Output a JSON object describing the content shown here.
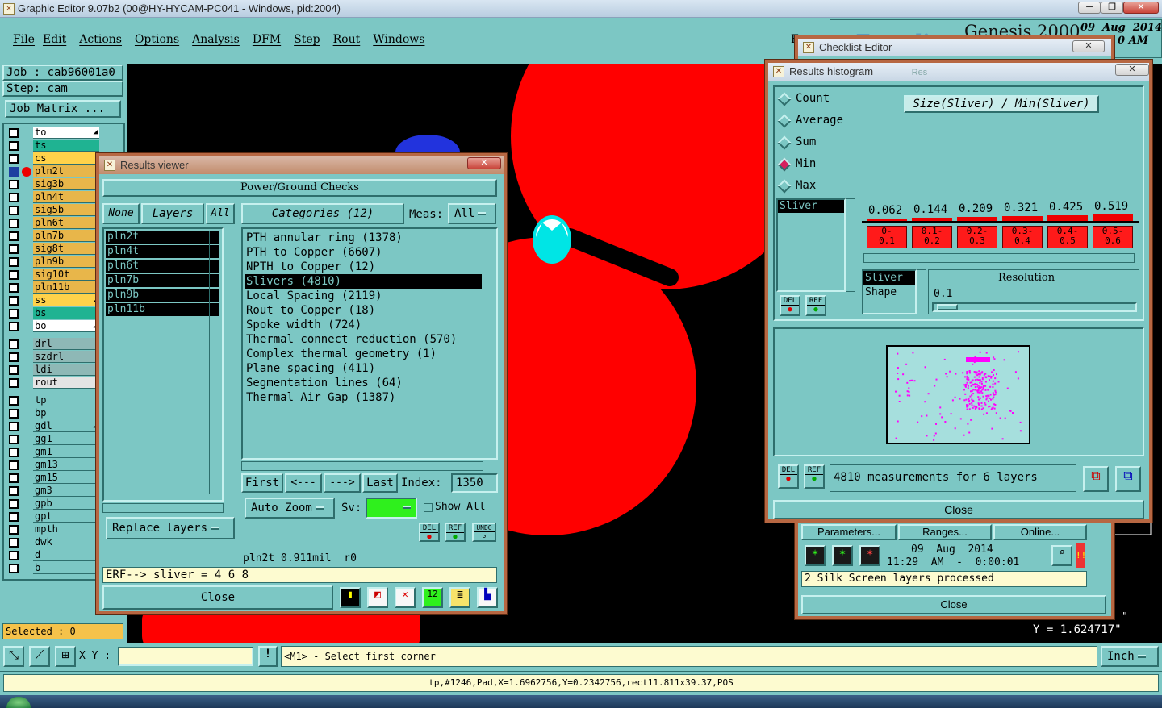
{
  "app": {
    "title": "Graphic Editor 9.07b2 (00@HY-HYCAM-PC041 - Windows, pid:2004)",
    "menu": [
      "File",
      "Edit",
      "Actions",
      "Options",
      "Analysis",
      "DFM",
      "Step",
      "Rout",
      "Windows"
    ],
    "brand": "Genesis 2000",
    "date": "09  Aug  2014",
    "time_suffix": "0 AM",
    "brand_watermark": "Frontline"
  },
  "job": {
    "job_label": "Job : cab96001a0",
    "step_label": "Step: cam",
    "matrix_button": "Job Matrix ..."
  },
  "layers": {
    "group1": [
      {
        "name": "to",
        "color": "#ffffff",
        "mark": "◢"
      },
      {
        "name": "ts",
        "color": "#1fb392",
        "mark": ""
      },
      {
        "name": "cs",
        "color": "#ffd24a",
        "mark": ""
      },
      {
        "name": "pln2t",
        "color": "#e8b64a",
        "mark": "",
        "active": true
      },
      {
        "name": "sig3b",
        "color": "#e8b64a",
        "mark": ""
      },
      {
        "name": "pln4t",
        "color": "#e8b64a",
        "mark": ""
      },
      {
        "name": "sig5b",
        "color": "#e8b64a",
        "mark": ""
      },
      {
        "name": "pln6t",
        "color": "#e8b64a",
        "mark": ""
      },
      {
        "name": "pln7b",
        "color": "#e8b64a",
        "mark": ""
      },
      {
        "name": "sig8t",
        "color": "#e8b64a",
        "mark": ""
      },
      {
        "name": "pln9b",
        "color": "#e8b64a",
        "mark": ""
      },
      {
        "name": "sig10t",
        "color": "#e8b64a",
        "mark": ""
      },
      {
        "name": "pln11b",
        "color": "#e8b64a",
        "mark": ""
      },
      {
        "name": "ss",
        "color": "#ffd24a",
        "mark": "◢"
      },
      {
        "name": "bs",
        "color": "#1fb392",
        "mark": ""
      },
      {
        "name": "bo",
        "color": "#ffffff",
        "mark": "◢"
      }
    ],
    "group2": [
      {
        "name": "drl",
        "color": "#8eb8b6"
      },
      {
        "name": "szdrl",
        "color": "#8eb8b6"
      },
      {
        "name": "ldi",
        "color": "#8eb8b6"
      },
      {
        "name": "rout",
        "color": "#e4e4e4"
      }
    ],
    "group3": [
      {
        "name": "tp",
        "color": "#7cc7c4",
        "mark": ""
      },
      {
        "name": "bp",
        "color": "#7cc7c4",
        "mark": ""
      },
      {
        "name": "gdl",
        "color": "#7cc7c4",
        "mark": "◢"
      },
      {
        "name": "gg1",
        "color": "#7cc7c4",
        "mark": ""
      },
      {
        "name": "gm1",
        "color": "#7cc7c4",
        "mark": ""
      },
      {
        "name": "gm13",
        "color": "#7cc7c4",
        "mark": ""
      },
      {
        "name": "gm15",
        "color": "#7cc7c4",
        "mark": ""
      },
      {
        "name": "gm3",
        "color": "#7cc7c4",
        "mark": ""
      },
      {
        "name": "gpb",
        "color": "#7cc7c4",
        "mark": ""
      },
      {
        "name": "gpt",
        "color": "#7cc7c4",
        "mark": ""
      },
      {
        "name": "mpth",
        "color": "#7cc7c4",
        "mark": ""
      },
      {
        "name": "dwk",
        "color": "#7cc7c4",
        "mark": ""
      },
      {
        "name": "d",
        "color": "#7cc7c4",
        "mark": ""
      },
      {
        "name": "b",
        "color": "#7cc7c4",
        "mark": ""
      }
    ],
    "selected_label": "Selected : 0"
  },
  "results_viewer": {
    "title": "Results viewer",
    "header": "Power/Ground Checks",
    "btn_none": "None",
    "btn_layers": "Layers",
    "btn_all": "All",
    "layer_list": [
      "pln2t",
      "pln4t",
      "pln6t",
      "pln7b",
      "pln9b",
      "pln11b"
    ],
    "categories_label": "Categories (12)",
    "meas_label": "Meas:",
    "meas_value": "All",
    "categories": [
      {
        "text": "PTH annular ring (1378)",
        "selected": false
      },
      {
        "text": "PTH to Copper (6607)",
        "selected": false
      },
      {
        "text": "NPTH to Copper (12)",
        "selected": false
      },
      {
        "text": "Slivers (4810)",
        "selected": true
      },
      {
        "text": "Local Spacing (2119)",
        "selected": false
      },
      {
        "text": "Rout to Copper (18)",
        "selected": false
      },
      {
        "text": "Spoke width (724)",
        "selected": false
      },
      {
        "text": "Thermal connect reduction (570)",
        "selected": false
      },
      {
        "text": "Complex thermal geometry (1)",
        "selected": false
      },
      {
        "text": "Plane spacing (411)",
        "selected": false
      },
      {
        "text": "Segmentation lines (64)",
        "selected": false
      },
      {
        "text": "Thermal Air Gap (1387)",
        "selected": false
      }
    ],
    "btn_first": "First",
    "btn_prev": "<---",
    "btn_next": "--->",
    "btn_last": "Last",
    "index_label": "Index:",
    "index_value": "1350",
    "auto_zoom": "Auto Zoom",
    "sv_label": "Sv:",
    "show_all": "Show All",
    "replace_layers": "Replace layers",
    "btn_del": "DEL",
    "btn_ref": "REF",
    "btn_undo": "UNDO",
    "status_line": "pln2t 0.911mil  r0",
    "erf_line": "ERF--> sliver = 4 6 8",
    "close": "Close"
  },
  "checklist_editor": {
    "title": "Checklist Editor",
    "parameters": "Parameters...",
    "ranges": "Ranges...",
    "online": "Online...",
    "date": "09  Aug  2014",
    "time": "11:29  AM  -  0:00:01",
    "status": "2 Silk Screen layers processed",
    "close": "Close"
  },
  "histogram": {
    "title": "Results histogram",
    "tab_ghost": "Res",
    "modes": [
      {
        "label": "Count",
        "selected": false
      },
      {
        "label": "Average",
        "selected": false
      },
      {
        "label": "Sum",
        "selected": false
      },
      {
        "label": "Min",
        "selected": true
      },
      {
        "label": "Max",
        "selected": false
      }
    ],
    "metric_list": [
      "Sliver"
    ],
    "chart_title": "Size(Sliver) / Min(Sliver)",
    "bars": [
      {
        "value": "0.062",
        "range": "0-\n0.1"
      },
      {
        "value": "0.144",
        "range": "0.1-\n0.2"
      },
      {
        "value": "0.209",
        "range": "0.2-\n0.3"
      },
      {
        "value": "0.321",
        "range": "0.3-\n0.4"
      },
      {
        "value": "0.425",
        "range": "0.4-\n0.5"
      },
      {
        "value": "0.519",
        "range": "0.5-\n0.6"
      }
    ],
    "attr_list": [
      "Sliver",
      "Shape"
    ],
    "resolution_label": "Resolution",
    "resolution_value": "0.1",
    "btn_del": "DEL",
    "btn_ref": "REF",
    "measurements": "4810 measurements for 6 layers",
    "close": "Close"
  },
  "coords": {
    "x_partial": "\"",
    "y_line": "Y = 1.624717\""
  },
  "statusbar": {
    "xy_label": "X Y :",
    "xy_value": "",
    "prompt": "<M1> - Select first corner",
    "units": "Inch",
    "bottom_text": "tp,#1246,Pad,X=1.6962756,Y=0.2342756,rect11.811x39.37,POS"
  },
  "colors": {
    "panel": "#7cc7c4",
    "canvas": "#000000",
    "copper": "#ff0000",
    "hilite": "#00e5e5",
    "sliver_dots": "#ff00ff"
  }
}
